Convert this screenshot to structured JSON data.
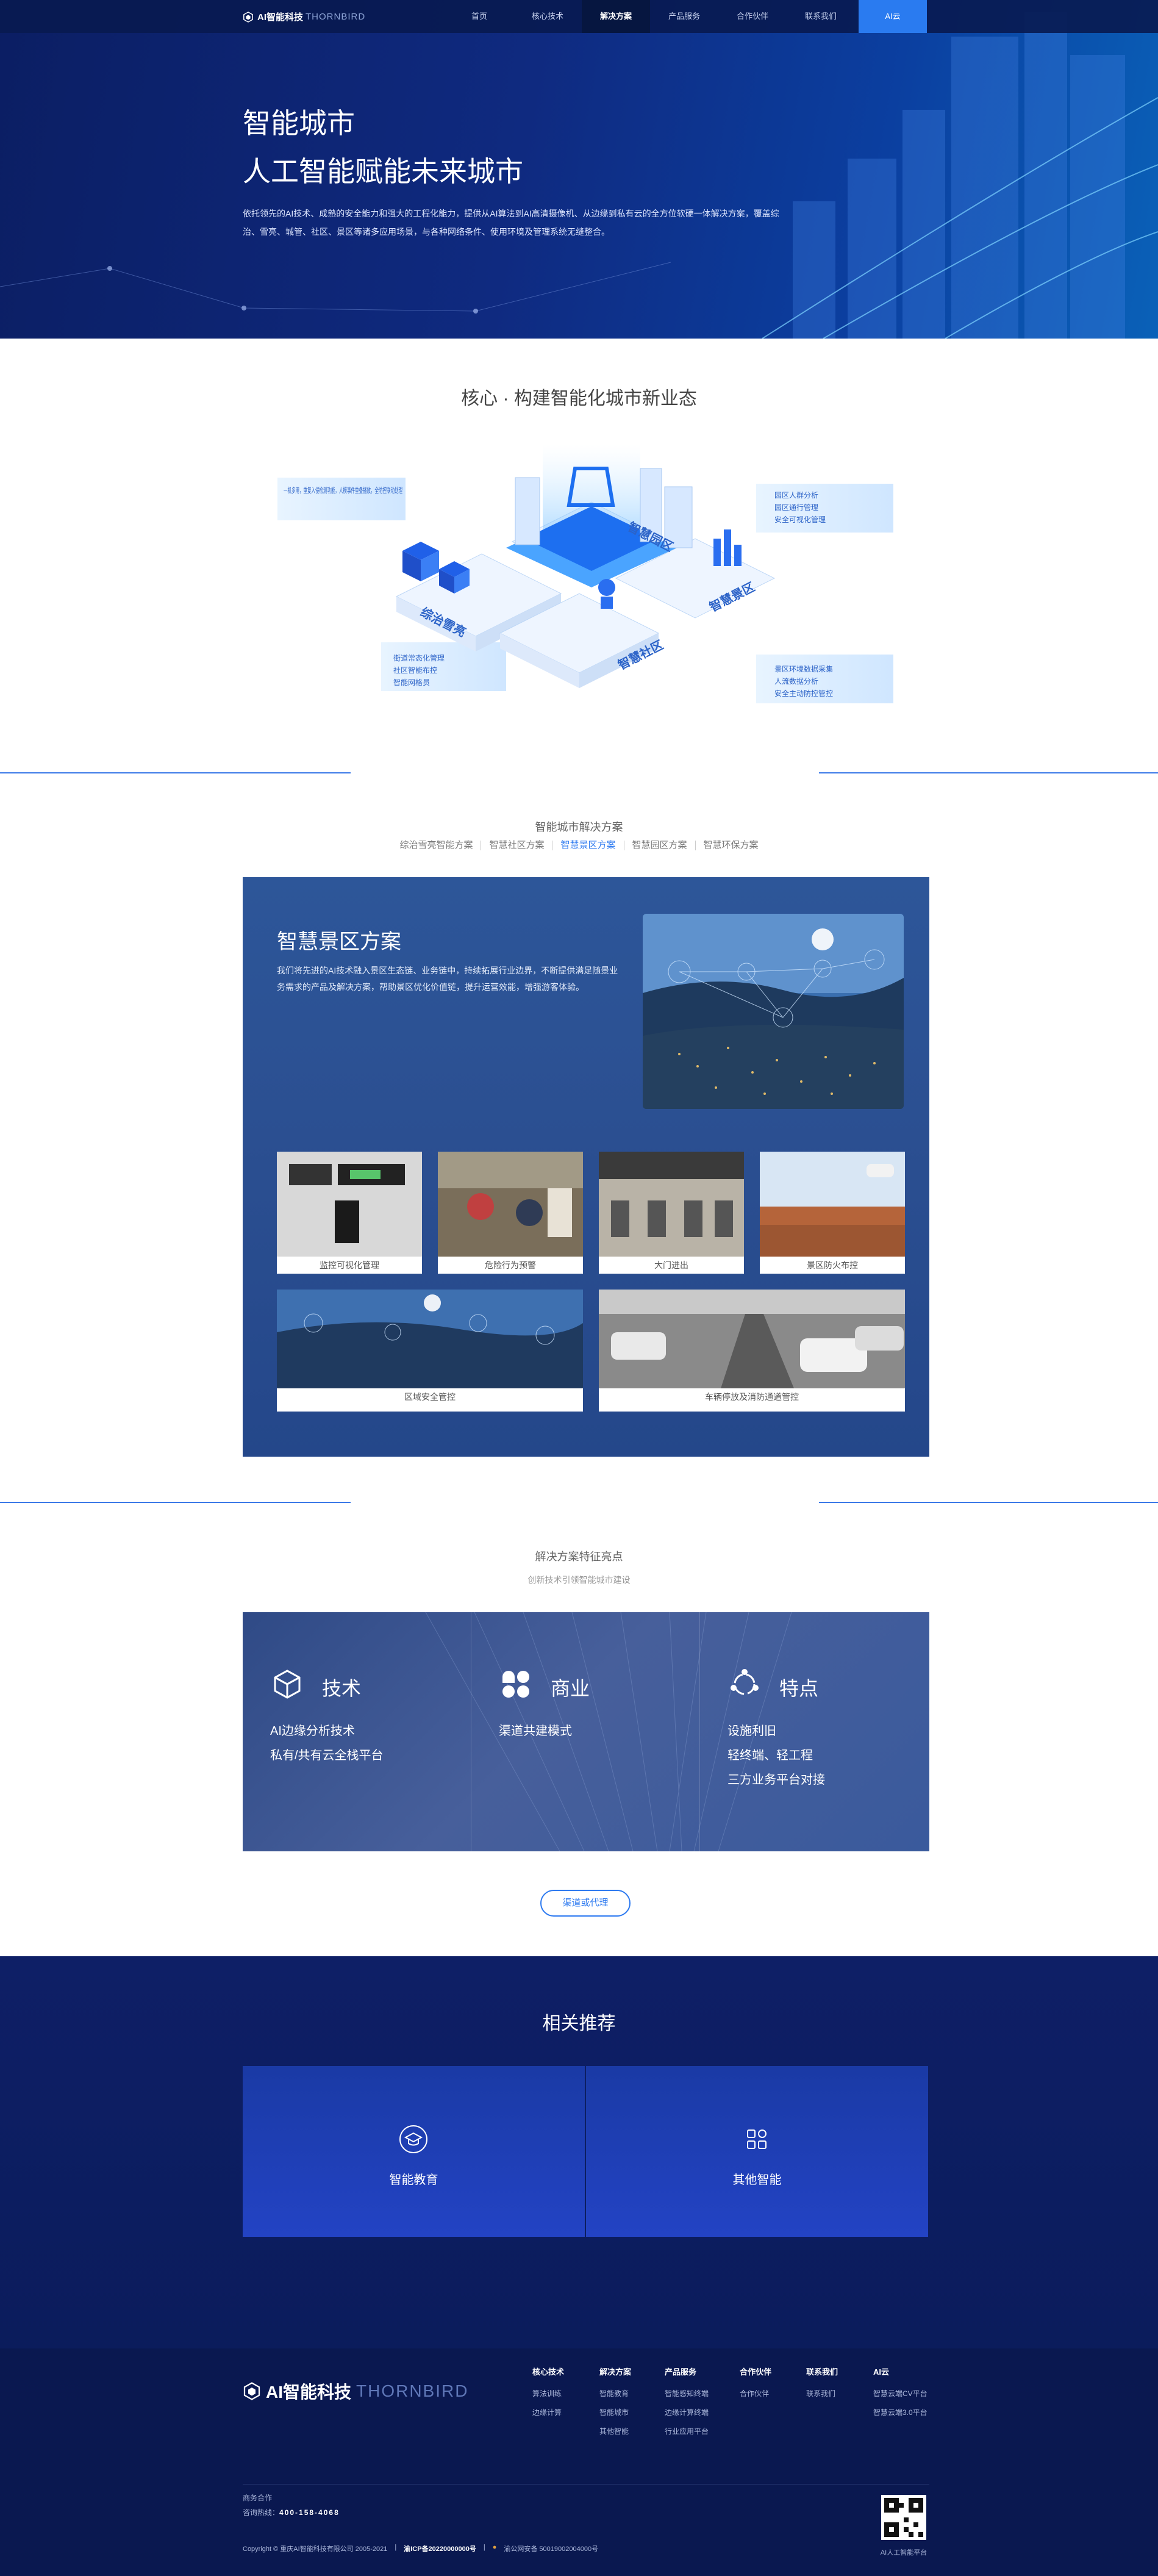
{
  "nav": {
    "brand": "AI智能科技",
    "brand_en": "THORNBIRD",
    "items": [
      "首页",
      "核心技术",
      "解决方案",
      "产品服务",
      "合作伙伴",
      "联系我们"
    ],
    "active_index": 2,
    "ai_cloud": "AI云"
  },
  "hero": {
    "title": "智能城市",
    "subtitle": "人工智能赋能未来城市",
    "desc": "依托领先的AI技术、成熟的安全能力和强大的工程化能力，提供从AI算法到AI高清摄像机、从边缘到私有云的全方位软硬一体解决方案，覆盖综治、雪亮、城管、社区、景区等诸多应用场景，与各种网络条件、使用环境及管理系统无缝整合。"
  },
  "core": {
    "title": "核心 · 构建智能化城市新业态",
    "left_note": "一机多用，重复入侵检测功能，人模事件重叠播放，全防控联动处理",
    "labels": [
      "综治雪亮",
      "智慧园区",
      "智慧社区",
      "智慧景区"
    ],
    "zongzhi_list": [
      "街道常态化管理",
      "社区智能布控",
      "智能网格员"
    ],
    "yuanqu_list": [
      "园区人群分析",
      "园区通行管理",
      "安全可视化管理"
    ],
    "jingqu_list": [
      "景区环境数据采集",
      "人流数据分析",
      "安全主动防控管控"
    ]
  },
  "solutions": {
    "heading": "智能城市解决方案",
    "tabs": [
      "综治雪亮智能方案",
      "智慧社区方案",
      "智慧景区方案",
      "智慧园区方案",
      "智慧环保方案"
    ],
    "active_tab": 2,
    "panel_title": "智慧景区方案",
    "panel_desc": "我们将先进的AI技术融入景区生态链、业务链中，持续拓展行业边界，不断提供满足随景业务需求的产品及解决方案，帮助景区优化价值链，提升运营效能，增强游客体验。",
    "cards": [
      "监控可视化管理",
      "危险行为预警",
      "大门进出",
      "景区防火布控",
      "区域安全管控",
      "车辆停放及消防通道管控"
    ]
  },
  "features": {
    "heading": "解决方案特征亮点",
    "subheading": "创新技术引领智能城市建设",
    "cols": [
      {
        "title": "技术",
        "icon": "cube-icon",
        "lines": [
          "AI边缘分析技术",
          "私有/共有云全栈平台"
        ]
      },
      {
        "title": "商业",
        "icon": "clover-icon",
        "lines": [
          "渠道共建模式"
        ]
      },
      {
        "title": "特点",
        "icon": "cycle-icon",
        "lines": [
          "设施利旧",
          "轻终端、轻工程",
          "三方业务平台对接"
        ]
      }
    ],
    "cta": "渠道或代理"
  },
  "related": {
    "heading": "相关推荐",
    "items": [
      {
        "label": "智能教育",
        "icon": "graduation-cap-icon"
      },
      {
        "label": "其他智能",
        "icon": "grid-icon"
      }
    ]
  },
  "footer": {
    "logo": "AI智能科技",
    "logo_en": "THORNBIRD",
    "columns": [
      {
        "head": "核心技术",
        "items": [
          "算法训练",
          "边缘计算"
        ]
      },
      {
        "head": "解决方案",
        "items": [
          "智能教育",
          "智能城市",
          "其他智能"
        ]
      },
      {
        "head": "产品服务",
        "items": [
          "智能感知终端",
          "边缘计算终端",
          "行业应用平台"
        ]
      },
      {
        "head": "合作伙伴",
        "items": [
          "合作伙伴"
        ]
      },
      {
        "head": "联系我们",
        "items": [
          "联系我们"
        ]
      },
      {
        "head": "AI云",
        "items": [
          "智慧云端CV平台",
          "智慧云端3.0平台"
        ]
      }
    ],
    "hotline_label": "商务合作",
    "hotline_prefix": "咨询热线：",
    "hotline": "400-158-4068",
    "copyright": "Copyright © 重庆AI智能科技有限公司 2005-2021",
    "icp": "渝ICP备20220000000号",
    "police": "渝公网安备 50019002004000号",
    "qr_caption": "AI人工智能平台"
  },
  "colors": {
    "nav_bg": "#081a50",
    "accent": "#2d7af0",
    "footer_bg": "#0a1850",
    "panel_bg": "#2b4f91"
  }
}
